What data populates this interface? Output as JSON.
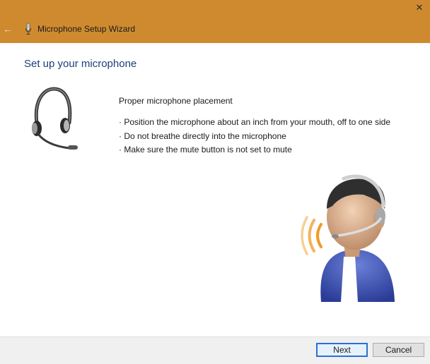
{
  "window": {
    "title": "Microphone Setup Wizard",
    "back_symbol": "←",
    "close_symbol": "✕",
    "accent_color": "#cf8a30",
    "title_icon": "microphone-icon"
  },
  "page": {
    "title": "Set up your microphone",
    "placement_heading": "Proper microphone placement",
    "tips": [
      "· Position the microphone about an inch from your mouth, off to one side",
      "· Do not breathe directly into the microphone",
      "· Make sure the mute button is not set to mute"
    ],
    "illustrations": [
      "headset-icon",
      "person-with-headset-illustration"
    ]
  },
  "footer": {
    "next_label": "Next",
    "cancel_label": "Cancel"
  }
}
